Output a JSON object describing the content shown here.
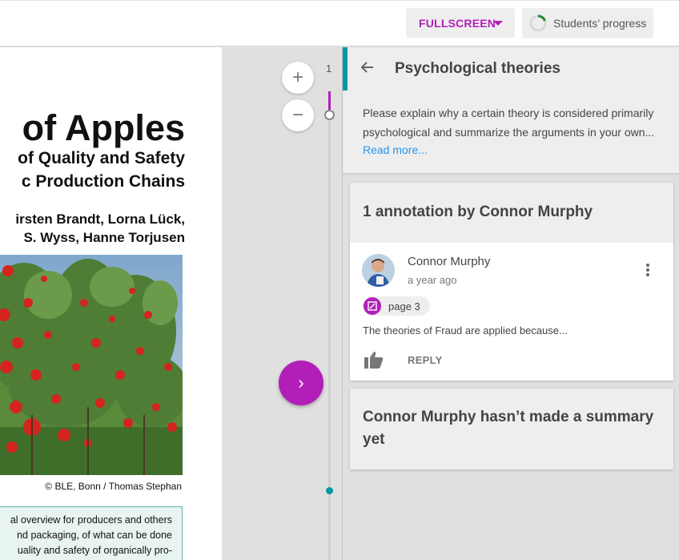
{
  "toolbar": {
    "fullscreen_label": "FULLSCREEN",
    "progress_label": "Students’ progress"
  },
  "document": {
    "title": "of Apples",
    "subtitle_1": "of Quality and Safety",
    "subtitle_2": "c Production Chains",
    "authors_1": "irsten Brandt, Lorna Lück,",
    "authors_2": "S. Wyss, Hanne Torjusen",
    "photo_credit": "© BLE, Bonn / Thomas Stephan",
    "box_lines": [
      "al overview for producers and others",
      "nd packaging, of what can be done",
      "uality and safety of organically pro-"
    ]
  },
  "viewer": {
    "zoom_in": "+",
    "zoom_out": "−",
    "page_number": "1",
    "next": "›"
  },
  "task": {
    "title": "Psychological theories",
    "description": "Please explain why a certain theory is considered primarily psychological and summarize the arguments in your own...",
    "read_more": "Read more..."
  },
  "annotations": {
    "header": "1 annotation by Connor Murphy",
    "items": [
      {
        "author": "Connor Murphy",
        "time": "a year ago",
        "page_label": "page 3",
        "text": "The theories of Fraud are applied because...",
        "reply_label": "REPLY"
      }
    ]
  },
  "summary": {
    "text": "Connor Murphy hasn’t made a summary yet"
  },
  "colors": {
    "accent": "#b21fb8",
    "teal": "#0097a7",
    "link": "#2196f3"
  },
  "icons": {
    "back": "arrow-left-icon",
    "progress": "progress-ring-icon",
    "like": "thumb-up-icon",
    "more": "more-vert-icon",
    "page": "annotation-page-icon"
  }
}
